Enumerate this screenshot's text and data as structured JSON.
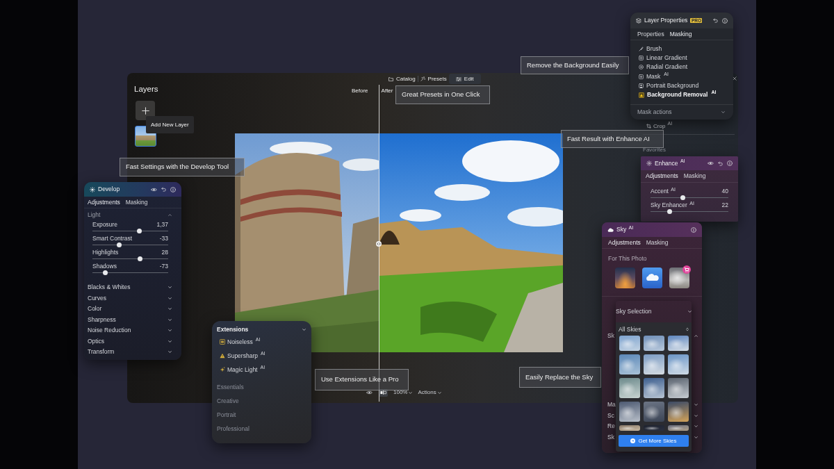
{
  "main_window": {
    "tabs": [
      {
        "label": "Catalog",
        "kind": "catalog",
        "selected": false
      },
      {
        "label": "Presets",
        "kind": "presets",
        "selected": false
      },
      {
        "label": "Edit",
        "kind": "edit",
        "selected": true
      }
    ],
    "layers": {
      "title": "Layers",
      "tooltip": "Add New Layer"
    },
    "compare": {
      "before": "Before",
      "after": "After"
    },
    "toolbar": {
      "zoom": "100%",
      "actions": "Actions"
    },
    "side_items": [
      {
        "label": "Crop $^{AI}$",
        "kind": "crop"
      },
      {
        "label": "Favorites",
        "kind": "heading"
      }
    ]
  },
  "captions": [
    "Remove the Background Easily",
    "Great Presets in One Click",
    "Fast Result with Enhance AI",
    "Fast Settings with the Develop Tool",
    "Use Extensions Like a Pro",
    "Easily Replace the Sky"
  ],
  "layer_properties": {
    "title": "Layer Properties",
    "badge": "PRO",
    "tabs": [
      {
        "label": "Properties",
        "selected": false
      },
      {
        "label": "Masking",
        "selected": true
      }
    ],
    "tools": [
      {
        "label": "Brush",
        "kind": "brush",
        "selected": false
      },
      {
        "label": "Linear Gradient",
        "kind": "linear",
        "selected": false
      },
      {
        "label": "Radial Gradient",
        "kind": "radial",
        "selected": false
      },
      {
        "label": "Mask $^{AI}$",
        "kind": "mask",
        "selected": false
      },
      {
        "label": "Portrait Background",
        "kind": "portrait",
        "selected": false
      },
      {
        "label": "Background Removal $^{AI}$",
        "kind": "removal",
        "selected": true
      }
    ],
    "footer": "Mask actions"
  },
  "enhance": {
    "title": "Enhance $^{AI}$",
    "tabs": [
      {
        "label": "Adjustments",
        "selected": true
      },
      {
        "label": "Masking",
        "selected": false
      }
    ],
    "sliders": [
      {
        "name": "Accent $^{AI}$",
        "reading": "40",
        "level": 0.41
      },
      {
        "name": "Sky Enhancer $^{AI}$",
        "reading": "22",
        "level": 0.23
      }
    ]
  },
  "develop": {
    "title": "Develop",
    "tabs": [
      {
        "label": "Adjustments",
        "selected": true
      },
      {
        "label": "Masking",
        "selected": false
      }
    ],
    "sections": [
      {
        "label": "Light",
        "expanded": true,
        "sliders": [
          {
            "name": "Exposure",
            "reading": "1,37",
            "level": 0.63
          },
          {
            "name": "Smart Contrast",
            "reading": "-33",
            "level": 0.34
          },
          {
            "name": "Highlights",
            "reading": "28",
            "level": 0.64
          },
          {
            "name": "Shadows",
            "reading": "-73",
            "level": 0.15
          }
        ]
      },
      {
        "label": "Blacks & Whites",
        "expanded": false
      },
      {
        "label": "Curves",
        "expanded": false
      },
      {
        "label": "Color",
        "expanded": false
      },
      {
        "label": "Sharpness",
        "expanded": false
      },
      {
        "label": "Noise Reduction",
        "expanded": false
      },
      {
        "label": "Optics",
        "expanded": false
      },
      {
        "label": "Transform",
        "expanded": false
      }
    ]
  },
  "sky": {
    "title": "Sky $^{AI}$",
    "tabs": [
      {
        "label": "Adjustments",
        "selected": true
      },
      {
        "label": "Masking",
        "selected": false
      }
    ],
    "subtitle": "For This Photo",
    "presets": [
      {
        "kind": "sunset",
        "store": false
      },
      {
        "kind": "cloud",
        "store": false
      },
      {
        "kind": "overcast",
        "store": true
      }
    ],
    "sections": [
      {
        "label": "Sk",
        "expanded": true
      },
      {
        "label": "Ma",
        "expanded": false
      },
      {
        "label": "Sc",
        "expanded": false
      },
      {
        "label": "Re",
        "expanded": false
      },
      {
        "label": "Sk",
        "expanded": false
      }
    ],
    "dropdown": {
      "title": "Sky Selection",
      "filter": "All Skies",
      "button": "Get More Skies"
    }
  },
  "extensions": {
    "title": "Extensions",
    "items": [
      {
        "label": "Noiseless $^{AI}$",
        "kind": "noiseless"
      },
      {
        "label": "Supersharp $^{AI}$",
        "kind": "supersharp"
      },
      {
        "label": "Magic Light $^{AI}$",
        "kind": "magic"
      }
    ],
    "categories": [
      "Essentials",
      "Creative",
      "Portrait",
      "Professional"
    ]
  }
}
